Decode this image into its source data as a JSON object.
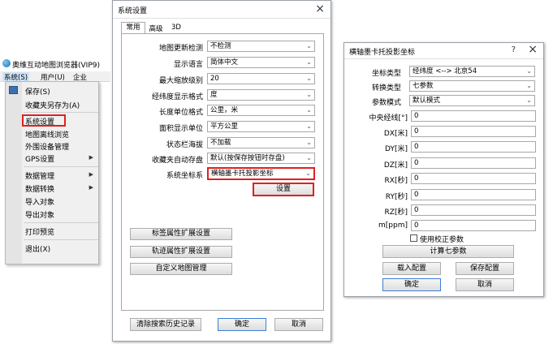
{
  "browser": {
    "title": "奥维互动地图浏览器(VIP9)",
    "menubar": [
      "系统(S)",
      "用户(U)",
      "企业"
    ],
    "menu": {
      "items": [
        {
          "label": "保存(S)"
        },
        {
          "label": "收藏夹另存为(A)"
        },
        {
          "label": "系统设置"
        },
        {
          "label": "地图离线浏览"
        },
        {
          "label": "外围设备管理"
        },
        {
          "label": "GPS设置"
        },
        {
          "label": "数据管理"
        },
        {
          "label": "数据转换"
        },
        {
          "label": "导入对象"
        },
        {
          "label": "导出对象"
        },
        {
          "label": "打印预览"
        },
        {
          "label": "退出(X)"
        }
      ]
    }
  },
  "settings": {
    "title": "系统设置",
    "tabs": [
      "常用",
      "高级",
      "3D"
    ],
    "rows": [
      {
        "label": "地图更新检测",
        "value": "不检测"
      },
      {
        "label": "显示语言",
        "value": "简体中文"
      },
      {
        "label": "最大缩放级别",
        "value": "20"
      },
      {
        "label": "经纬度显示格式",
        "value": "度"
      },
      {
        "label": "长度单位格式",
        "value": "公里，米"
      },
      {
        "label": "面积显示单位",
        "value": "平方公里"
      },
      {
        "label": "状态栏海拔",
        "value": "不加载"
      },
      {
        "label": "收藏夹自动存盘",
        "value": "默认(按保存按钮时存盘)"
      },
      {
        "label": "系统坐标系",
        "value": "横轴墨卡托投影坐标"
      }
    ],
    "setup_button": "设置",
    "ext_buttons": [
      "标签属性扩展设置",
      "轨迹属性扩展设置",
      "自定义地图管理"
    ],
    "clear_history": "清除搜索历史记录",
    "ok": "确定",
    "cancel": "取消"
  },
  "mercator": {
    "title": "横轴墨卡托投影坐标",
    "help": "?",
    "rows": [
      {
        "label": "坐标类型",
        "value": "经纬度 <--> 北京54"
      },
      {
        "label": "转换类型",
        "value": "七参数"
      },
      {
        "label": "参数模式",
        "value": "默认模式"
      }
    ],
    "params": [
      {
        "label": "中央经线[°]",
        "value": "0"
      },
      {
        "label": "DX[米]",
        "value": "0"
      },
      {
        "label": "DY[米]",
        "value": "0"
      },
      {
        "label": "DZ[米]",
        "value": "0"
      },
      {
        "label": "RX[秒]",
        "value": "0"
      },
      {
        "label": "RY[秒]",
        "value": "0"
      },
      {
        "label": "RZ[秒]",
        "value": "0"
      },
      {
        "label": "m[ppm]",
        "value": "0"
      }
    ],
    "checkbox": "使用校正参数",
    "calc_button": "计算七参数",
    "load_button": "载入配置",
    "save_button": "保存配置",
    "ok": "确定",
    "cancel": "取消"
  },
  "colors": {
    "highlight": "#e02020",
    "selected_row": "#1e78d2",
    "menu_bg": "#f0f0f0"
  }
}
